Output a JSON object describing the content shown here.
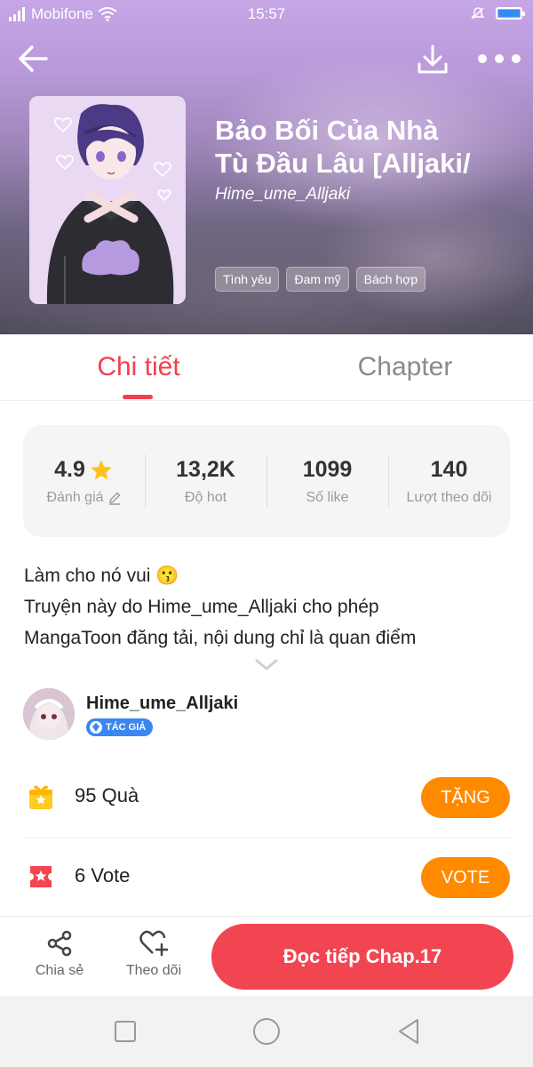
{
  "status_bar": {
    "carrier": "Mobifone",
    "time": "15:57"
  },
  "book": {
    "title_line1": "Bảo Bối Của Nhà",
    "title_line2": "Tù Đầu Lâu [Alljaki/",
    "author": "Hime_ume_Alljaki",
    "tags": [
      "Tình yêu",
      "Đam mỹ",
      "Bách hợp"
    ]
  },
  "tabs": [
    {
      "label": "Chi tiết"
    },
    {
      "label": "Chapter"
    }
  ],
  "stats": [
    {
      "value": "4.9",
      "label": "Đánh giá"
    },
    {
      "value": "13,2K",
      "label": "Độ hot"
    },
    {
      "value": "1099",
      "label": "Số like"
    },
    {
      "value": "140",
      "label": "Lượt theo dõi"
    }
  ],
  "description": {
    "line1": "Làm cho nó vui 😗",
    "line2": "Truyện này do Hime_ume_Alljaki cho phép",
    "line3": "MangaToon đăng tải, nội dung chỉ là quan điểm"
  },
  "author": {
    "name": "Hime_ume_Alljaki",
    "badge": "TÁC GIẢ"
  },
  "gift": {
    "count": "95",
    "label": "Quà",
    "button": "TẶNG"
  },
  "vote": {
    "count": "6",
    "label": "Vote",
    "button": "VOTE"
  },
  "bottom_bar": {
    "share_label": "Chia sẻ",
    "follow_label": "Theo dõi",
    "read_button": "Đọc tiếp Chap.17"
  },
  "colors": {
    "accent_red": "#f24552",
    "tab_active": "#f0404f",
    "orange_button": "#ff8a00",
    "badge_blue": "#3a86f2"
  }
}
